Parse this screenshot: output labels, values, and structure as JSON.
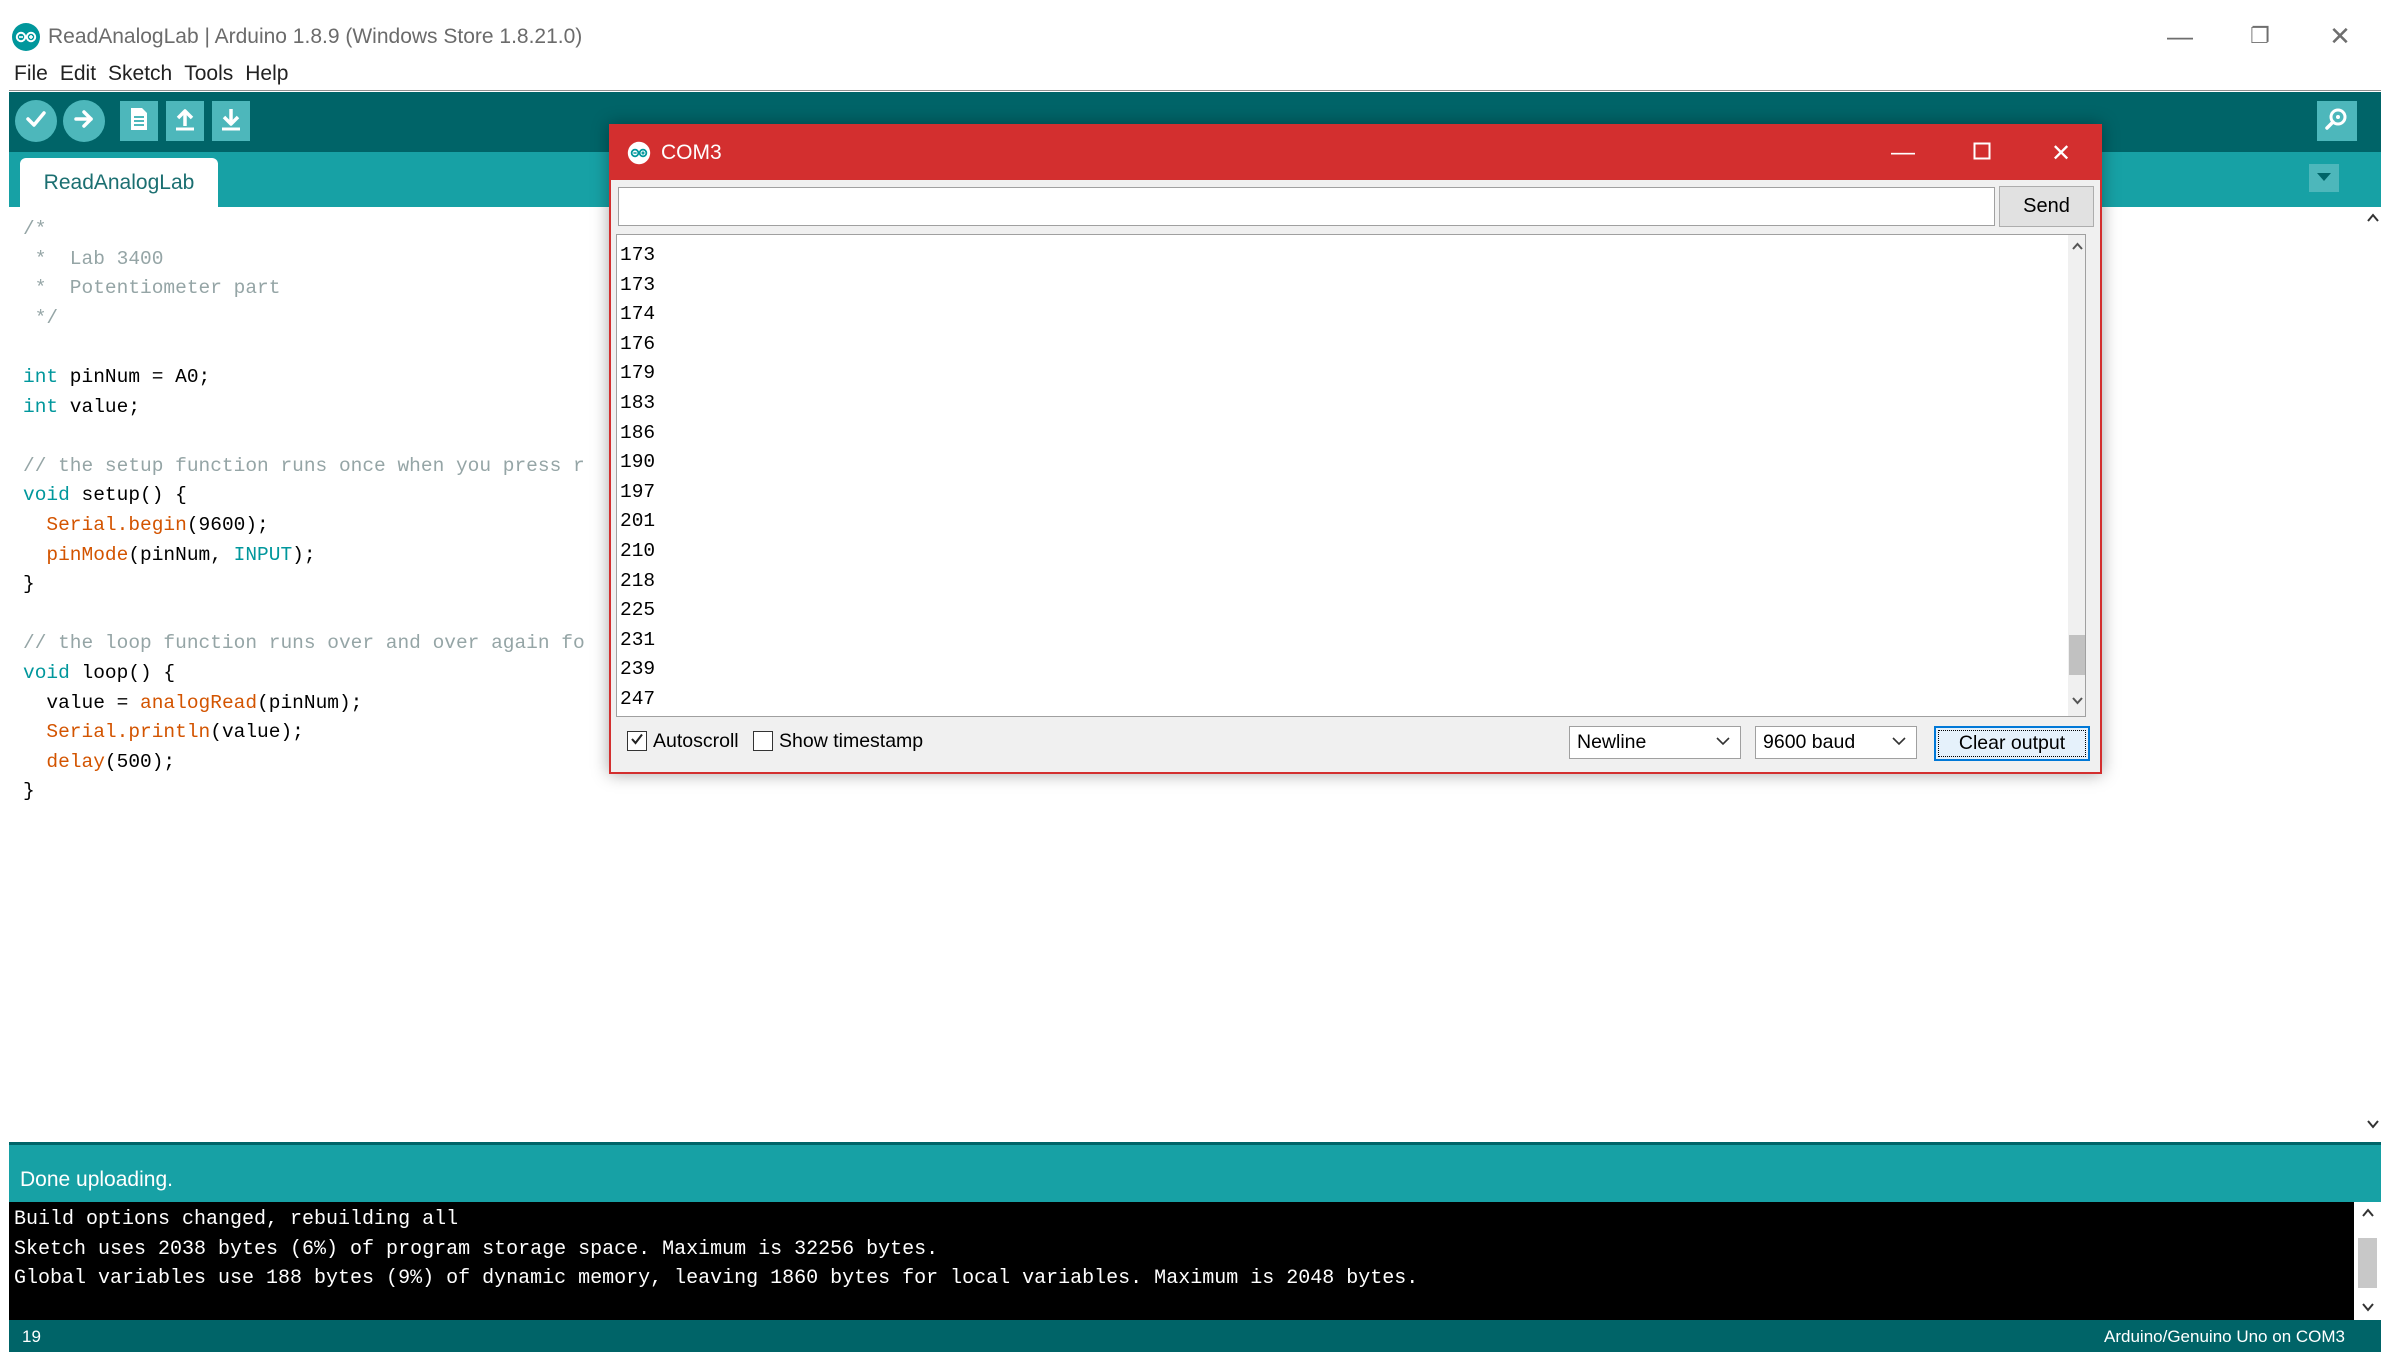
{
  "window": {
    "title": "ReadAnalogLab | Arduino 1.8.9 (Windows Store 1.8.21.0)",
    "minimize": "—",
    "restore": "❐",
    "close": "✕"
  },
  "menu": {
    "items": [
      {
        "label": "File"
      },
      {
        "label": "Edit"
      },
      {
        "label": "Sketch"
      },
      {
        "label": "Tools"
      },
      {
        "label": "Help"
      }
    ]
  },
  "toolbar": {
    "buttons": [
      "verify-icon",
      "upload-icon",
      "new-icon",
      "open-icon",
      "save-icon"
    ],
    "serial_monitor_icon": "magnifier-icon"
  },
  "tabs": {
    "active": "ReadAnalogLab"
  },
  "editor": {
    "code_lines": [
      "/*",
      " *  Lab 3400",
      " *  Potentiometer part",
      " */",
      "",
      "int pinNum = A0;",
      "int value;",
      "",
      "// the setup function runs once when you press r",
      "void setup() {",
      "  Serial.begin(9600);",
      "  pinMode(pinNum, INPUT);",
      "}",
      "",
      "// the loop function runs over and over again fo",
      "void loop() {",
      "  value = analogRead(pinNum);",
      "  Serial.println(value);",
      "  delay(500);",
      "}"
    ]
  },
  "status": {
    "message": "Done uploading.",
    "console": [
      "Build options changed, rebuilding all",
      "Sketch uses 2038 bytes (6%) of program storage space. Maximum is 32256 bytes.",
      "Global variables use 188 bytes (9%) of dynamic memory, leaving 1860 bytes for local variables. Maximum is 2048 bytes."
    ],
    "line_number": "19",
    "board": "Arduino/Genuino Uno on COM3"
  },
  "serial_monitor": {
    "title": "COM3",
    "input_value": "",
    "send_label": "Send",
    "output_lines": [
      "173",
      "173",
      "174",
      "176",
      "179",
      "183",
      "186",
      "190",
      "197",
      "201",
      "210",
      "218",
      "225",
      "231",
      "239",
      "247"
    ],
    "autoscroll_label": "Autoscroll",
    "autoscroll_checked": true,
    "timestamp_label": "Show timestamp",
    "timestamp_checked": false,
    "line_ending": "Newline",
    "baud_rate": "9600 baud",
    "clear_label": "Clear output"
  },
  "colors": {
    "toolbar": "#006468",
    "tabbar": "#17a1a5",
    "button": "#4db7bb",
    "serial_title": "#d32f2f",
    "keyword": "#00979c",
    "function": "#d35400",
    "comment": "#95a5a6"
  }
}
